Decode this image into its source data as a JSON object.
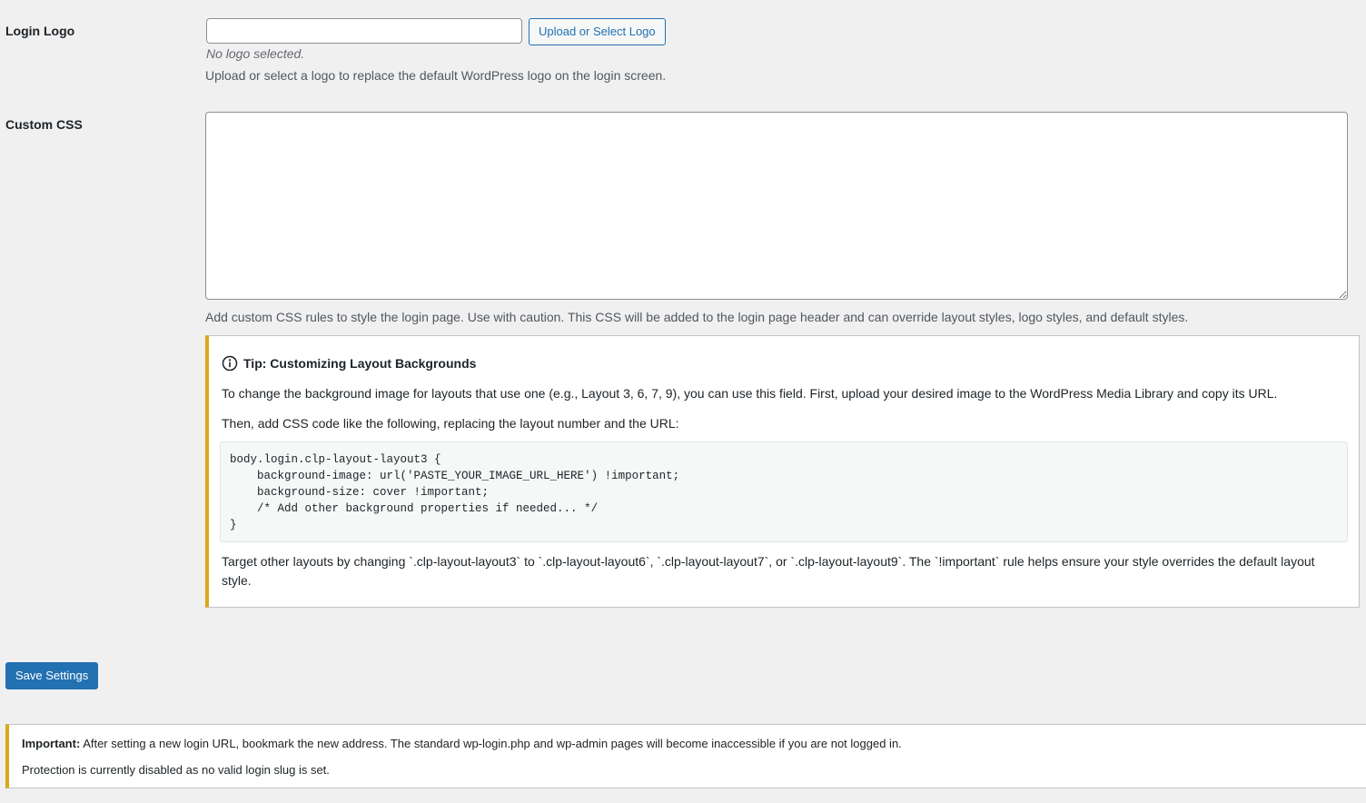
{
  "login_logo": {
    "label": "Login Logo",
    "input_value": "",
    "upload_button_label": "Upload or Select Logo",
    "status_text": "No logo selected.",
    "description": "Upload or select a logo to replace the default WordPress logo on the login screen."
  },
  "custom_css": {
    "label": "Custom CSS",
    "textarea_value": "",
    "description": "Add custom CSS rules to style the login page. Use with caution. This CSS will be added to the login page header and can override layout styles, logo styles, and default styles."
  },
  "tip": {
    "icon": "info-icon",
    "title": "Tip: Customizing Layout Backgrounds",
    "paragraph_1": "To change the background image for layouts that use one (e.g., Layout 3, 6, 7, 9), you can use this field. First, upload your desired image to the WordPress Media Library and copy its URL.",
    "paragraph_2": "Then, add CSS code like the following, replacing the layout number and the URL:",
    "code": "body.login.clp-layout-layout3 {\n    background-image: url('PASTE_YOUR_IMAGE_URL_HERE') !important;\n    background-size: cover !important;\n    /* Add other background properties if needed... */\n}",
    "paragraph_3": "Target other layouts by changing `.clp-layout-layout3` to `.clp-layout-layout6`, `.clp-layout-layout7`, or `.clp-layout-layout9`. The `!important` rule helps ensure your style overrides the default layout style."
  },
  "save_button_label": "Save Settings",
  "notice": {
    "strong_text": "Important:",
    "line_1": "After setting a new login URL, bookmark the new address. The standard wp-login.php and wp-admin pages will become inaccessible if you are not logged in.",
    "line_2": "Protection is currently disabled as no valid login slug is set."
  },
  "colors": {
    "page_background": "#f0f0f1",
    "primary_blue": "#2271b1",
    "warning_accent": "#dba617"
  }
}
